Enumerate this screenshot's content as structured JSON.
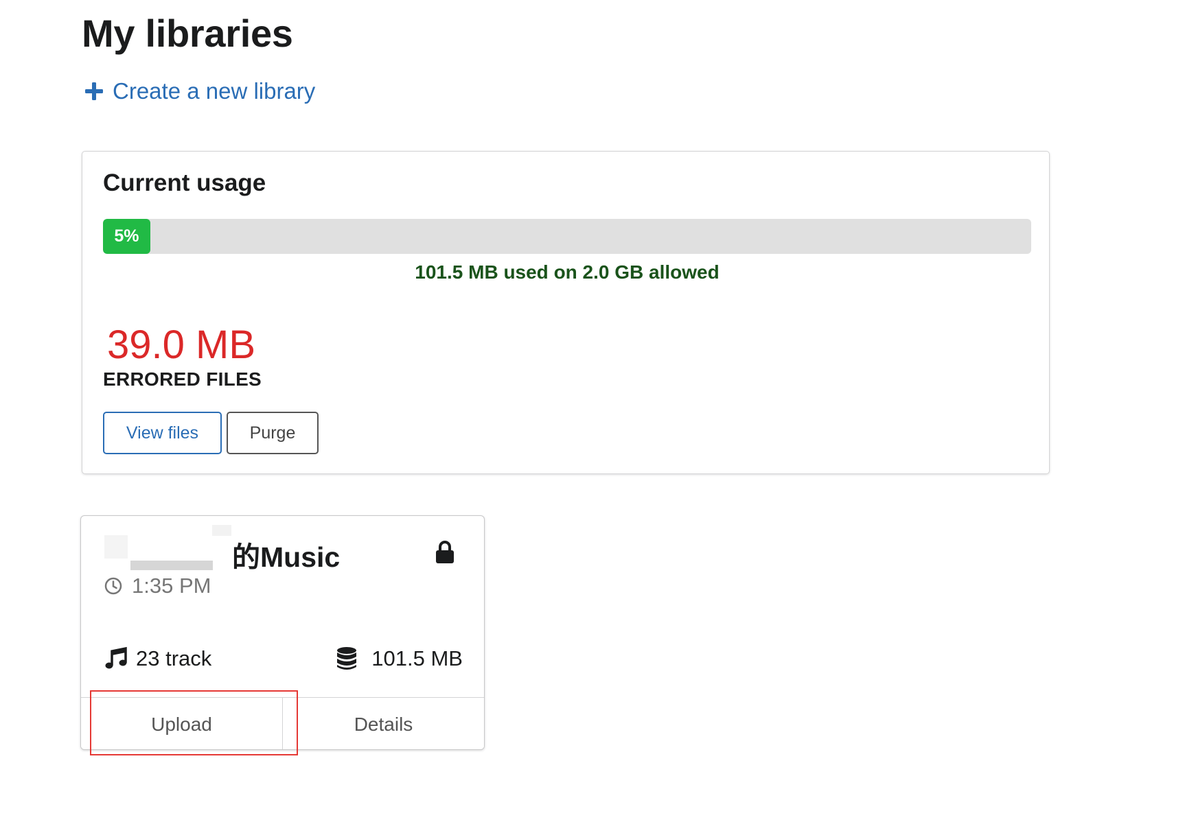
{
  "page": {
    "title": "My libraries"
  },
  "create_link": {
    "label": "Create a new library"
  },
  "usage": {
    "title": "Current usage",
    "progress_percent": 5,
    "progress_label": "5%",
    "usage_text": "101.5 MB used on 2.0 GB allowed",
    "errored_size": "39.0 MB",
    "errored_label": "ERRORED FILES",
    "view_files_label": "View files",
    "purge_label": "Purge"
  },
  "library": {
    "name_suffix": "的Music",
    "time": "1:35 PM",
    "tracks": "23 track",
    "size": "101.5 MB",
    "upload_label": "Upload",
    "details_label": "Details",
    "icons": {
      "lock": "lock-icon",
      "clock": "clock-icon",
      "tracks": "music-note-icon",
      "size": "database-icon"
    }
  },
  "colors": {
    "link_blue": "#2a6db5",
    "progress_green": "#21ba45",
    "usage_text_green": "#1a531b",
    "error_red": "#db2828",
    "highlight_red": "#e53935"
  }
}
